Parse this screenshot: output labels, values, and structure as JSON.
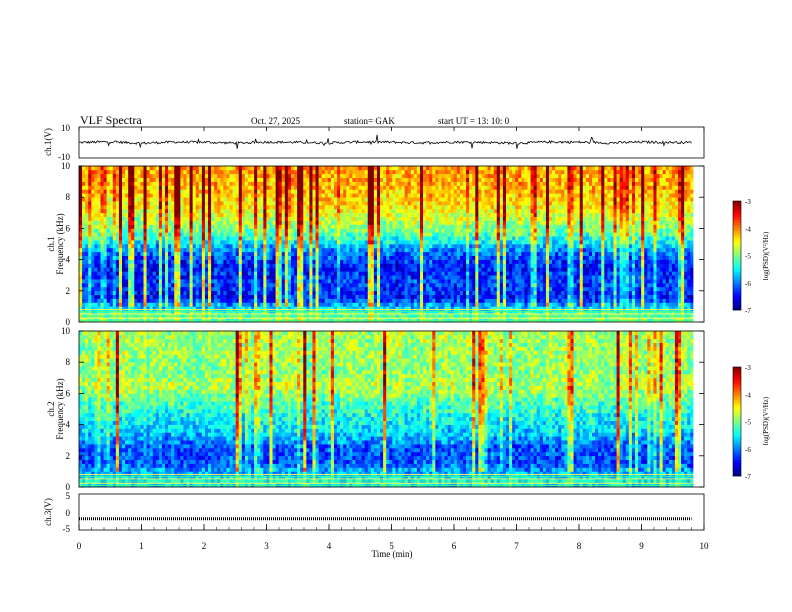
{
  "header": {
    "title": "VLF  Spectra",
    "date": "Oct. 27, 2025",
    "station": "station= GAK",
    "start": "start  UT  =    13: 10: 0"
  },
  "chart_data": [
    {
      "type": "line",
      "panel": "ch1-waveform",
      "ylabel": "ch.1(V)",
      "ylim": [
        -10,
        10
      ],
      "yticks": [
        "10",
        "-10"
      ],
      "x": [
        0,
        0.5,
        1,
        1.5,
        2,
        2.5,
        3,
        3.5,
        4,
        4.5,
        5,
        5.5,
        6,
        6.5,
        7,
        7.5,
        8,
        8.5,
        9,
        9.5,
        9.8
      ],
      "values": [
        0,
        0.5,
        -0.5,
        0.3,
        0.2,
        -0.4,
        0.3,
        0.1,
        -0.3,
        0.4,
        0.2,
        -0.2,
        0.3,
        0.1,
        -0.5,
        0.4,
        0.2,
        -0.3,
        0.3,
        0.1,
        0
      ]
    },
    {
      "type": "heatmap",
      "panel": "ch1-spectrogram",
      "ylabel": "ch.1\nFrequency  (kHz)",
      "ylim": [
        0,
        10
      ],
      "yticks": [
        "0",
        "2",
        "4",
        "6",
        "8",
        "10"
      ],
      "colorbar": {
        "label": "log(PSD)(V²/Hz)",
        "range": [
          -7,
          -3
        ],
        "ticks": [
          "-3",
          "-4",
          "-5",
          "-6",
          "-7"
        ]
      },
      "xlim": [
        0,
        9.83
      ],
      "freq_kHz": [
        0.5,
        1.5,
        2.5,
        3.5,
        4.5,
        5.5,
        6.5,
        7.5,
        8.5,
        9.5
      ],
      "log_psd_profile": [
        -5.2,
        -6.6,
        -6.4,
        -6.6,
        -6.2,
        -5.4,
        -4.9,
        -4.6,
        -4.4,
        -4.3
      ],
      "time_variation": "vertical impulsive streaks across all frequencies throughout"
    },
    {
      "type": "heatmap",
      "panel": "ch2-spectrogram",
      "ylabel": "ch.2\nFrequency  (kHz)",
      "ylim": [
        0,
        10
      ],
      "yticks": [
        "0",
        "2",
        "4",
        "6",
        "8",
        "10"
      ],
      "colorbar": {
        "label": "log(PSD)(V²/Hz)",
        "range": [
          -7,
          -3
        ],
        "ticks": [
          "-3",
          "-4",
          "-5",
          "-6",
          "-7"
        ]
      },
      "xlim": [
        0,
        9.83
      ],
      "freq_kHz": [
        0.5,
        1.5,
        2.5,
        3.5,
        4.5,
        5.5,
        6.5,
        7.5,
        8.5,
        9.5
      ],
      "log_psd_profile": [
        -5.6,
        -6.3,
        -6.3,
        -5.8,
        -5.6,
        -5.3,
        -4.9,
        -5.1,
        -5.0,
        -5.0
      ],
      "time_variation": "vertical impulsive streaks; emission band near 6 kHz"
    },
    {
      "type": "line",
      "panel": "ch3-waveform",
      "ylabel": "ch.3(V)",
      "ylim": [
        -5,
        5
      ],
      "yticks": [
        "5",
        "0",
        "-5"
      ],
      "x": [
        0,
        9.8
      ],
      "values": [
        -2,
        -2
      ]
    }
  ],
  "xaxis": {
    "label": "Time  (min)",
    "range": [
      0,
      10
    ],
    "ticks": [
      "0",
      "1",
      "2",
      "3",
      "4",
      "5",
      "6",
      "7",
      "8",
      "9",
      "10"
    ]
  }
}
